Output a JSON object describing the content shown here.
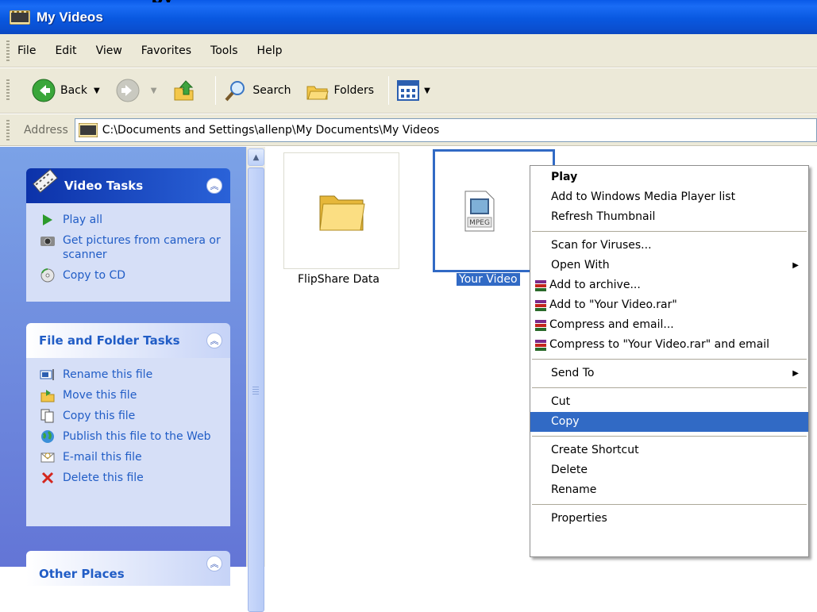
{
  "window": {
    "title": "My Videos",
    "top_fragment": "py"
  },
  "menu": [
    "File",
    "Edit",
    "View",
    "Favorites",
    "Tools",
    "Help"
  ],
  "toolbar": {
    "back": "Back",
    "search": "Search",
    "folders": "Folders"
  },
  "address": {
    "label": "Address",
    "path": "C:\\Documents and Settings\\allenp\\My Documents\\My Videos"
  },
  "video_tasks": {
    "title": "Video Tasks",
    "items": [
      "Play all",
      "Get pictures from camera or scanner",
      "Copy to CD"
    ]
  },
  "file_tasks": {
    "title": "File and Folder Tasks",
    "items": [
      "Rename this file",
      "Move this file",
      "Copy this file",
      "Publish this file to the Web",
      "E-mail this file",
      "Delete this file"
    ]
  },
  "other_places": {
    "title": "Other Places"
  },
  "files": [
    {
      "name": "FlipShare Data",
      "type": "folder"
    },
    {
      "name": "Your Video",
      "type": "mpeg",
      "badge": "MPEG"
    }
  ],
  "context_menu": {
    "play": "Play",
    "add_wmp": "Add to Windows Media Player list",
    "refresh": "Refresh Thumbnail",
    "scan": "Scan for Viruses...",
    "open_with": "Open With",
    "add_archive": "Add to archive...",
    "add_rar": "Add to \"Your Video.rar\"",
    "compress_email": "Compress and email...",
    "compress_rar_email": "Compress to \"Your Video.rar\" and email",
    "send_to": "Send To",
    "cut": "Cut",
    "copy": "Copy",
    "create_shortcut": "Create Shortcut",
    "delete": "Delete",
    "rename": "Rename",
    "properties": "Properties"
  },
  "colors": {
    "title_bar": "#0a58e0",
    "selection": "#316ac5",
    "task_pane": "#7ba2e7"
  }
}
